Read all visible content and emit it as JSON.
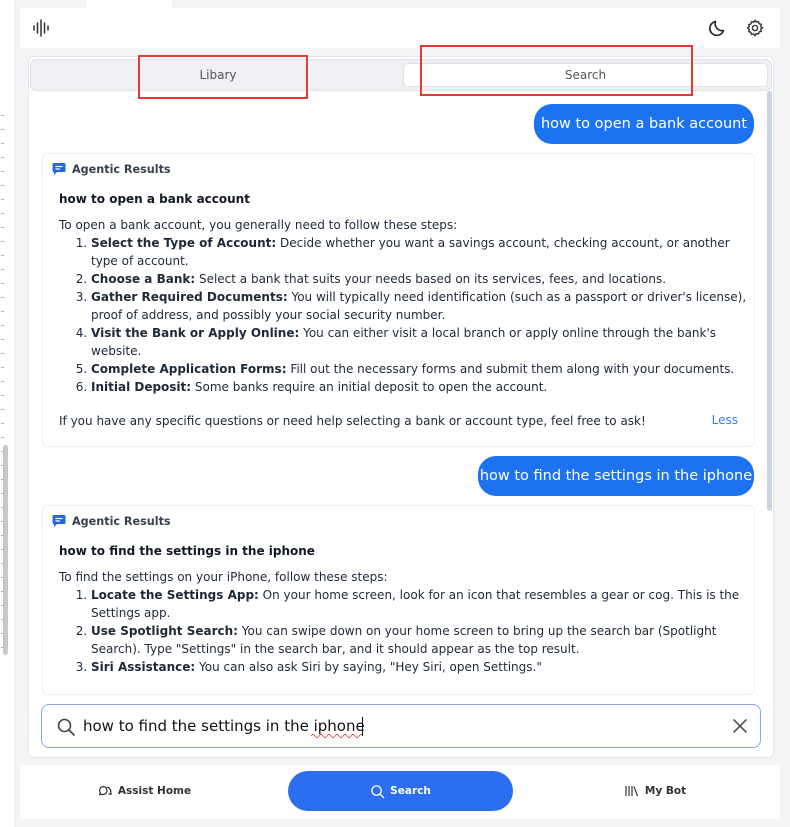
{
  "header": {
    "logo_icon": "audio-waveform-icon",
    "theme_icon": "moon-icon",
    "settings_icon": "gear-icon"
  },
  "tabs": [
    {
      "label": "Libary"
    },
    {
      "label": "Search"
    }
  ],
  "chat": {
    "messages": [
      {
        "role": "user",
        "text": "how to open a bank account"
      },
      {
        "role": "result",
        "header": "Agentic Results",
        "title": "how to open a bank account",
        "intro": "To open a bank account, you generally need to follow these steps:",
        "steps": [
          {
            "bold": "Select the Type of Account:",
            "text": " Decide whether you want a savings account, checking account, or another type of account."
          },
          {
            "bold": "Choose a Bank:",
            "text": " Select a bank that suits your needs based on its services, fees, and locations."
          },
          {
            "bold": "Gather Required Documents:",
            "text": " You will typically need identification (such as a passport or driver's license), proof of address, and possibly your social security number."
          },
          {
            "bold": "Visit the Bank or Apply Online:",
            "text": " You can either visit a local branch or apply online through the bank's website."
          },
          {
            "bold": "Complete Application Forms:",
            "text": " Fill out the necessary forms and submit them along with your documents."
          },
          {
            "bold": "Initial Deposit:",
            "text": " Some banks require an initial deposit to open the account."
          }
        ],
        "outro": "If you have any specific questions or need help selecting a bank or account type, feel free to ask!",
        "less_label": "Less"
      },
      {
        "role": "user",
        "text": "how to find the settings in the iphone"
      },
      {
        "role": "result",
        "header": "Agentic Results",
        "title": "how to find the settings in the iphone",
        "intro": "To find the settings on your iPhone, follow these steps:",
        "steps": [
          {
            "bold": "Locate the Settings App:",
            "text": " On your home screen, look for an icon that resembles a gear or cog. This is the Settings app."
          },
          {
            "bold": "Use Spotlight Search:",
            "text": " You can swipe down on your home screen to bring up the search bar (Spotlight Search). Type \"Settings\" in the search bar, and it should appear as the top result."
          },
          {
            "bold": "Siri Assistance:",
            "text": " You can also ask Siri by saying, \"Hey Siri, open Settings.\""
          }
        ]
      }
    ]
  },
  "search": {
    "value": "how to find the settings in the iphone",
    "search_icon": "search-icon",
    "clear_icon": "close-icon"
  },
  "bottom_nav": {
    "home_label": "Assist Home",
    "search_label": "Search",
    "mybot_label": "My Bot"
  },
  "colors": {
    "accent": "#1d72f0",
    "highlight_box": "#e53935",
    "link": "#3b7de8"
  }
}
